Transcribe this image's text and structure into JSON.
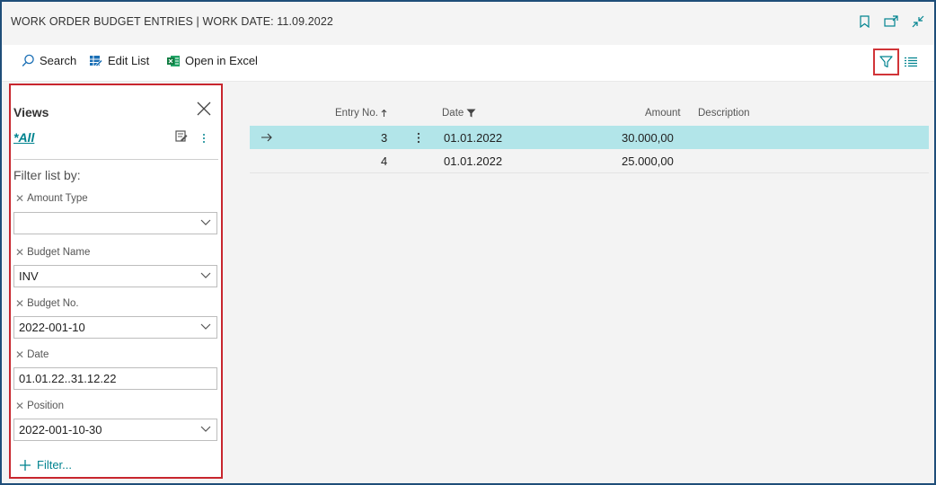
{
  "window": {
    "title": "WORK ORDER BUDGET ENTRIES | WORK DATE: 11.09.2022",
    "icons": [
      "bookmark-icon",
      "open-new-window-icon",
      "collapse-icon"
    ]
  },
  "toolbar": {
    "search_label": "Search",
    "edit_list_label": "Edit List",
    "open_excel_label": "Open in Excel"
  },
  "views_panel": {
    "title": "Views",
    "all_label": "*All",
    "filter_heading": "Filter list by:",
    "filters": [
      {
        "label": "Amount Type",
        "value": "",
        "type": "dropdown"
      },
      {
        "label": "Budget Name",
        "value": "INV",
        "type": "dropdown"
      },
      {
        "label": "Budget No.",
        "value": "2022-001-10",
        "type": "dropdown"
      },
      {
        "label": "Date",
        "value": "01.01.22..31.12.22",
        "type": "text"
      },
      {
        "label": "Position",
        "value": "2022-001-10-30",
        "type": "dropdown"
      }
    ],
    "add_filter_label": "Filter..."
  },
  "table": {
    "columns": {
      "entry_no": "Entry No.",
      "date": "Date",
      "amount": "Amount",
      "description": "Description"
    },
    "rows": [
      {
        "entry_no": "3",
        "date": "01.01.2022",
        "amount": "30.000,00",
        "description": "",
        "selected": true
      },
      {
        "entry_no": "4",
        "date": "01.01.2022",
        "amount": "25.000,00",
        "description": "",
        "selected": false
      }
    ]
  },
  "colors": {
    "accent": "#00838f",
    "selected_row": "#b2e5e9",
    "highlight_border": "#d13438"
  }
}
